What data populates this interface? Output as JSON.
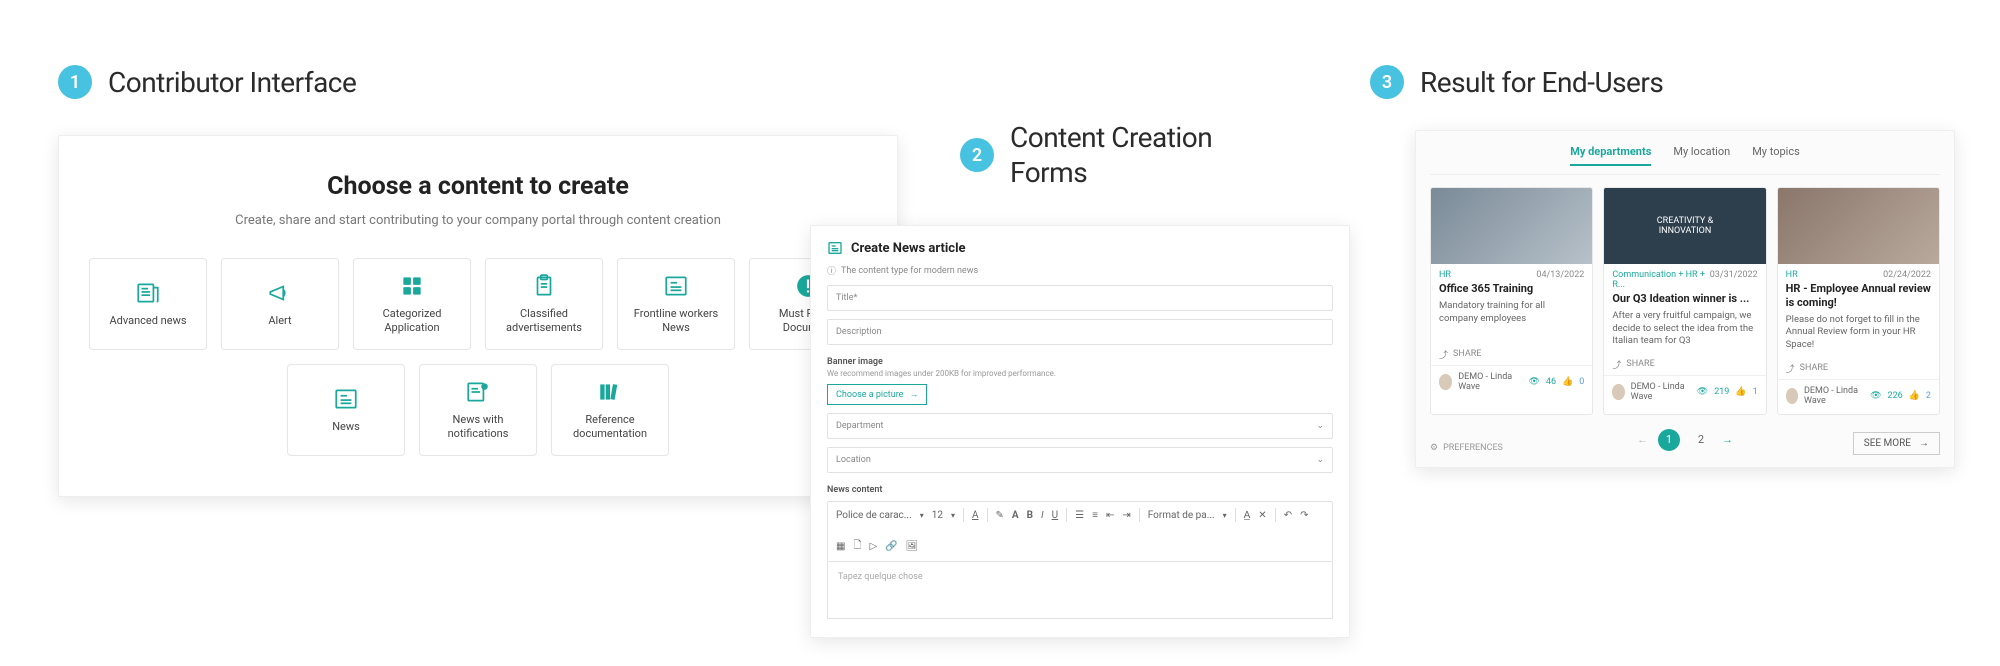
{
  "stages": {
    "s1": {
      "num": "1",
      "title": "Contributor Interface"
    },
    "s2": {
      "num": "2",
      "title": "Content Creation\nForms"
    },
    "s3": {
      "num": "3",
      "title": "Result for End-Users"
    }
  },
  "panel1": {
    "heading": "Choose a content to create",
    "subtitle": "Create, share and start contributing to your company portal through content creation",
    "tiles": [
      {
        "label": "Advanced news",
        "icon": "newspaper"
      },
      {
        "label": "Alert",
        "icon": "megaphone"
      },
      {
        "label": "Categorized Application",
        "icon": "grid"
      },
      {
        "label": "Classified advertisements",
        "icon": "clipboard"
      },
      {
        "label": "Frontline workers News",
        "icon": "news"
      },
      {
        "label": "Must Read - Document",
        "icon": "alert"
      },
      {
        "label": "News",
        "icon": "news"
      },
      {
        "label": "News with notifications",
        "icon": "news-bell"
      },
      {
        "label": "Reference documentation",
        "icon": "books"
      }
    ]
  },
  "panel2": {
    "form_title": "Create News article",
    "hint": "The content type for modern news",
    "fields": {
      "title_ph": "Title*",
      "desc_ph": "Description",
      "banner_label": "Banner image",
      "banner_hint": "We recommend images under 200KB for improved performance.",
      "pic_btn": "Choose a picture",
      "dept_ph": "Department",
      "loc_ph": "Location",
      "content_label": "News content",
      "editor_ph": "Tapez quelque chose"
    },
    "toolbar": {
      "font_family": "Police de carac...",
      "font_size": "12",
      "format": "Format de pa..."
    }
  },
  "panel3": {
    "tabs": [
      "My departments",
      "My location",
      "My topics"
    ],
    "active_tab": 0,
    "cards": [
      {
        "category": "HR",
        "date": "04/13/2022",
        "title": "Office 365 Training",
        "desc": "Mandatory training for all company employees",
        "thumb_text": "",
        "author": "DEMO - Linda Wave",
        "views": "46",
        "likes": "0"
      },
      {
        "category": "Communication + HR + R...",
        "date": "03/31/2022",
        "title": "Our Q3 Ideation winner is ...",
        "desc": "After a very fruitful campaign, we decide to select the idea from the Italian team for Q3",
        "thumb_text": "CREATIVITY &\nINNOVATION",
        "author": "DEMO - Linda Wave",
        "views": "219",
        "likes": "1"
      },
      {
        "category": "HR",
        "date": "02/24/2022",
        "title": "HR - Employee Annual review is coming!",
        "desc": "Please do not forget to fill in the Annual Review form in your HR Space!",
        "thumb_text": "",
        "author": "DEMO - Linda Wave",
        "views": "226",
        "likes": "2"
      }
    ],
    "share_label": "SHARE",
    "prefs_label": "PREFERENCES",
    "pagination": {
      "current": "1",
      "next": "2"
    },
    "see_more": "SEE MORE"
  },
  "colors": {
    "accent": "#47c2e0",
    "teal": "#1aa89c"
  }
}
